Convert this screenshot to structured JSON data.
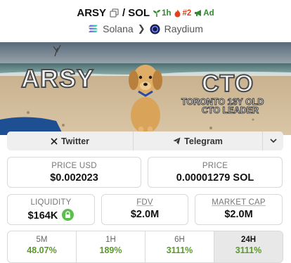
{
  "pair": {
    "base": "ARSY",
    "separator": "/",
    "quote": "SOL",
    "age": "1h",
    "rank": "#2",
    "ad": "Ad"
  },
  "breadcrumb": {
    "chain": "Solana",
    "dex": "Raydium"
  },
  "banner": {
    "left_text": "ARSY",
    "right_title": "CTO",
    "right_line1": "TORONTO 13Y OLD",
    "right_line2": "CTO LEADER"
  },
  "links": {
    "twitter": "Twitter",
    "telegram": "Telegram"
  },
  "stats": {
    "price_usd_label": "PRICE USD",
    "price_usd": "$0.002023",
    "price_label": "PRICE",
    "price": "0.00001279 SOL",
    "liquidity_label": "LIQUIDITY",
    "liquidity": "$164K",
    "fdv_label": "FDV",
    "fdv": "$2.0M",
    "mcap_label": "MARKET CAP",
    "mcap": "$2.0M"
  },
  "timeframes": [
    {
      "label": "5M",
      "value": "48.07%"
    },
    {
      "label": "1H",
      "value": "189%"
    },
    {
      "label": "6H",
      "value": "3111%"
    },
    {
      "label": "24H",
      "value": "3111%"
    }
  ],
  "colors": {
    "positive": "#5a9a2a",
    "rank": "#e0431a",
    "ad": "#2e8b2e"
  },
  "icons": [
    "copy-icon",
    "seedling-icon",
    "fire-icon",
    "megaphone-icon",
    "solana-icon",
    "raydium-icon",
    "x-logo-icon",
    "telegram-icon",
    "chevron-down-icon",
    "lock-icon"
  ]
}
